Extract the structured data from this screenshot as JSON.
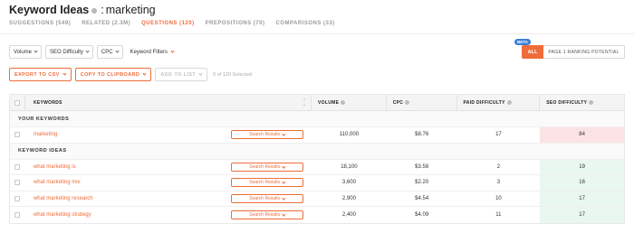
{
  "header": {
    "title": "Keyword Ideas",
    "colon": ":",
    "query": "marketing"
  },
  "tabs": [
    {
      "label": "SUGGESTIONS (549)",
      "active": false
    },
    {
      "label": "RELATED (2.3M)",
      "active": false
    },
    {
      "label": "QUESTIONS (120)",
      "active": true
    },
    {
      "label": "PREPOSITIONS (70)",
      "active": false
    },
    {
      "label": "COMPARISONS (33)",
      "active": false
    }
  ],
  "filters": {
    "volume": "Volume",
    "seo_difficulty": "SEO Difficulty",
    "cpc": "CPC",
    "keyword_filters": "Keyword Filters"
  },
  "toggle": {
    "beta": "BETA",
    "all": "ALL",
    "page1": "PAGE 1 RANKING POTENTIAL"
  },
  "actions": {
    "export_csv": "EXPORT TO CSV",
    "copy_clipboard": "COPY TO CLIPBOARD",
    "add_to_list": "ADD TO LIST",
    "selected": "0 of 120 Selected"
  },
  "table": {
    "columns": {
      "keywords": "KEYWORDS",
      "volume": "VOLUME",
      "cpc": "CPC",
      "paid_difficulty": "PAID DIFFICULTY",
      "seo_difficulty": "SEO DIFFICULTY"
    },
    "search_results_label": "Search Results",
    "your_keywords_label": "YOUR KEYWORDS",
    "keyword_ideas_label": "KEYWORD IDEAS",
    "your_keywords": [
      {
        "keyword": "marketing",
        "volume": "110,000",
        "cpc": "$8.76",
        "paid": "17",
        "seo": "84",
        "seo_level": "hard"
      }
    ],
    "keyword_ideas": [
      {
        "keyword": "what marketing is",
        "volume": "18,100",
        "cpc": "$3.58",
        "paid": "2",
        "seo": "19",
        "seo_level": "easy"
      },
      {
        "keyword": "what marketing mix",
        "volume": "3,600",
        "cpc": "$2.20",
        "paid": "3",
        "seo": "16",
        "seo_level": "easy"
      },
      {
        "keyword": "what marketing research",
        "volume": "2,900",
        "cpc": "$4.54",
        "paid": "10",
        "seo": "17",
        "seo_level": "easy"
      },
      {
        "keyword": "what marketing strategy",
        "volume": "2,400",
        "cpc": "$4.09",
        "paid": "11",
        "seo": "17",
        "seo_level": "easy"
      }
    ]
  },
  "colors": {
    "accent": "#ef6c3a",
    "beta": "#3d7fd6",
    "seo_hard": "#fbe3e5",
    "seo_easy": "#e9f7ef"
  }
}
